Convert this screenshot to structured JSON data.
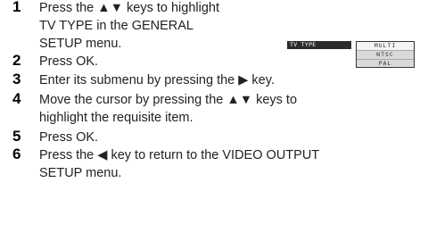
{
  "steps": [
    {
      "number": "1",
      "lines": [
        "Press the ▲▼ keys to highlight",
        "TV TYPE in the GENERAL",
        "SETUP menu."
      ]
    },
    {
      "number": "2",
      "lines": [
        "Press OK."
      ]
    },
    {
      "number": "3",
      "lines": [
        "Enter its submenu by pressing the ▶ key."
      ]
    },
    {
      "number": "4",
      "lines": [
        "Move the cursor by pressing the ▲▼ keys to",
        "highlight the requisite item."
      ]
    },
    {
      "number": "5",
      "lines": [
        "Press OK."
      ]
    },
    {
      "number": "6",
      "lines": [
        "Press the ◀ key to return to the VIDEO OUTPUT",
        "SETUP menu."
      ]
    }
  ],
  "menu": {
    "label": "TV  TYPE",
    "options": [
      "MULTI",
      "NTSC",
      "PAL"
    ]
  }
}
